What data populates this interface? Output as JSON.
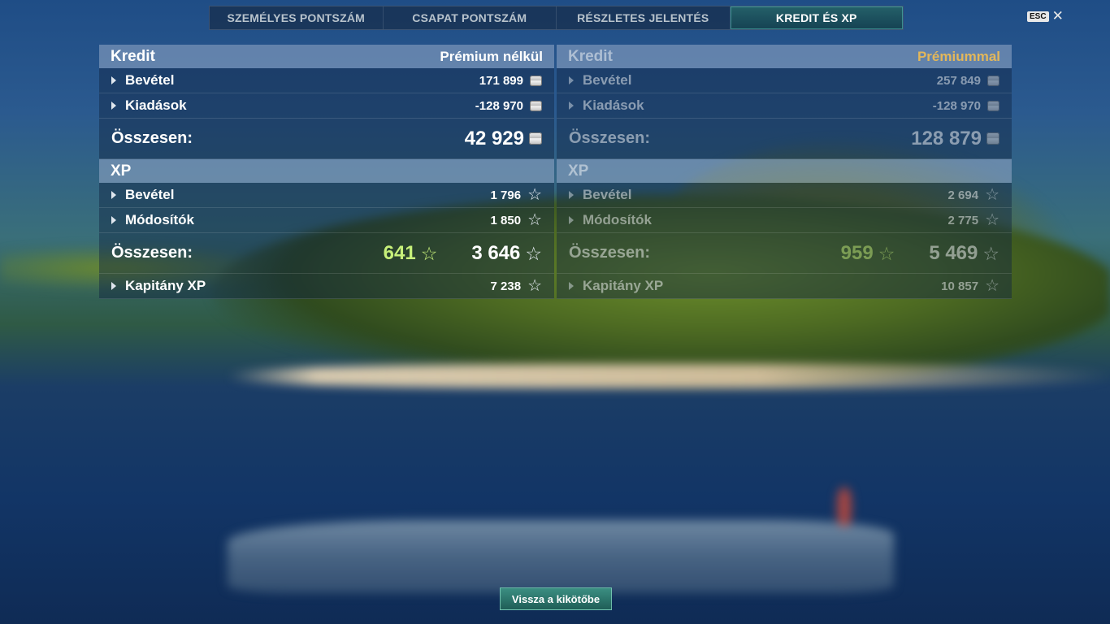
{
  "tabs": [
    {
      "label": "SZEMÉLYES PONTSZÁM"
    },
    {
      "label": "CSAPAT PONTSZÁM"
    },
    {
      "label": "RÉSZLETES JELENTÉS"
    },
    {
      "label": "KREDIT ÉS XP",
      "active": true
    }
  ],
  "esc_label": "ESC",
  "left": {
    "credit_header": "Kredit",
    "credit_sub": "Prémium nélkül",
    "income_label": "Bevétel",
    "income_value": "171 899",
    "expense_label": "Kiadások",
    "expense_value": "-128 970",
    "credit_total_label": "Összesen:",
    "credit_total_value": "42 929",
    "xp_header": "XP",
    "xp_income_label": "Bevétel",
    "xp_income_value": "1 796",
    "xp_mod_label": "Módosítók",
    "xp_mod_value": "1 850",
    "xp_total_label": "Összesen:",
    "xp_total_bonus": "641",
    "xp_total_value": "3 646",
    "captain_label": "Kapitány XP",
    "captain_value": "7 238"
  },
  "right": {
    "credit_header": "Kredit",
    "credit_sub": "Prémiummal",
    "income_label": "Bevétel",
    "income_value": "257 849",
    "expense_label": "Kiadások",
    "expense_value": "-128 970",
    "credit_total_label": "Összesen:",
    "credit_total_value": "128 879",
    "xp_header": "XP",
    "xp_income_label": "Bevétel",
    "xp_income_value": "2 694",
    "xp_mod_label": "Módosítók",
    "xp_mod_value": "2 775",
    "xp_total_label": "Összesen:",
    "xp_total_bonus": "959",
    "xp_total_value": "5 469",
    "captain_label": "Kapitány XP",
    "captain_value": "10 857"
  },
  "back_button": "Vissza a kikötőbe",
  "colors": {
    "accent_teal": "#2f8f82",
    "premium_gold": "#e3b75a",
    "bonus_green": "#c7f07a"
  },
  "icons": {
    "credit": "credit-coin-icon",
    "xp": "xp-star-icon",
    "expand": "expand-triangle-icon",
    "close": "close-icon"
  }
}
